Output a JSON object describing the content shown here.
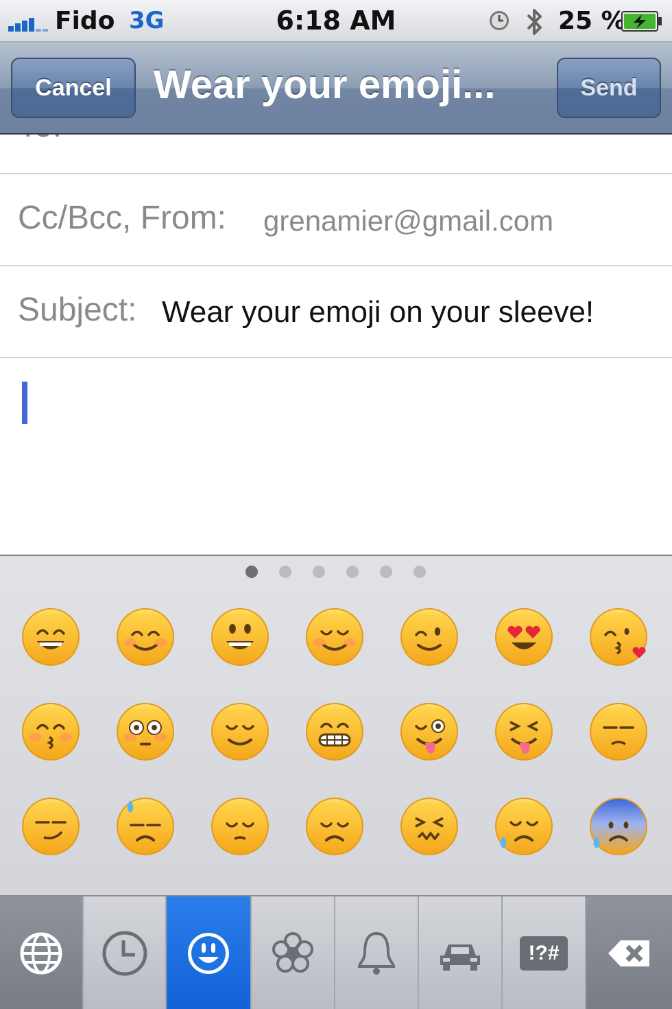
{
  "status_bar": {
    "carrier": "Fido",
    "network": "3G",
    "time": "6:18 AM",
    "battery_percent": "25 %",
    "icons": [
      "signal-bars-icon",
      "alarm-clock-icon",
      "bluetooth-icon",
      "battery-charging-icon"
    ]
  },
  "nav": {
    "cancel_label": "Cancel",
    "title": "Wear your emoji...",
    "send_label": "Send"
  },
  "compose": {
    "to_label": "To:",
    "cc_label": "Cc/Bcc, From:",
    "cc_value": "grenamier@gmail.com",
    "subject_label": "Subject:",
    "subject_value": "Wear your emoji on your sleeve!"
  },
  "keyboard": {
    "page_count": 6,
    "active_page": 1,
    "emoji_rows": [
      [
        "grinning-face",
        "smiling-face-smiling-eyes",
        "smiley",
        "relaxed-blushing",
        "winking-face",
        "heart-eyes",
        "face-blowing-kiss"
      ],
      [
        "kissing-closed-eyes",
        "flushed-face",
        "relieved-face",
        "grimacing-face",
        "stuck-out-tongue-winking",
        "stuck-out-tongue-closed-eyes",
        "unamused-face"
      ],
      [
        "smirking-face",
        "sweat-drop-face",
        "pensive-face",
        "disappointed-face",
        "confounded-face",
        "disappointed-relieved",
        "cold-sweat-face"
      ]
    ],
    "tabs": [
      "globe-icon",
      "recent-clock-icon",
      "smiley-icon",
      "flower-icon",
      "bell-icon",
      "car-icon",
      "symbols-key-icon",
      "delete-key-icon"
    ],
    "symbols_label": "!?#",
    "active_tab": "smiley-icon"
  }
}
